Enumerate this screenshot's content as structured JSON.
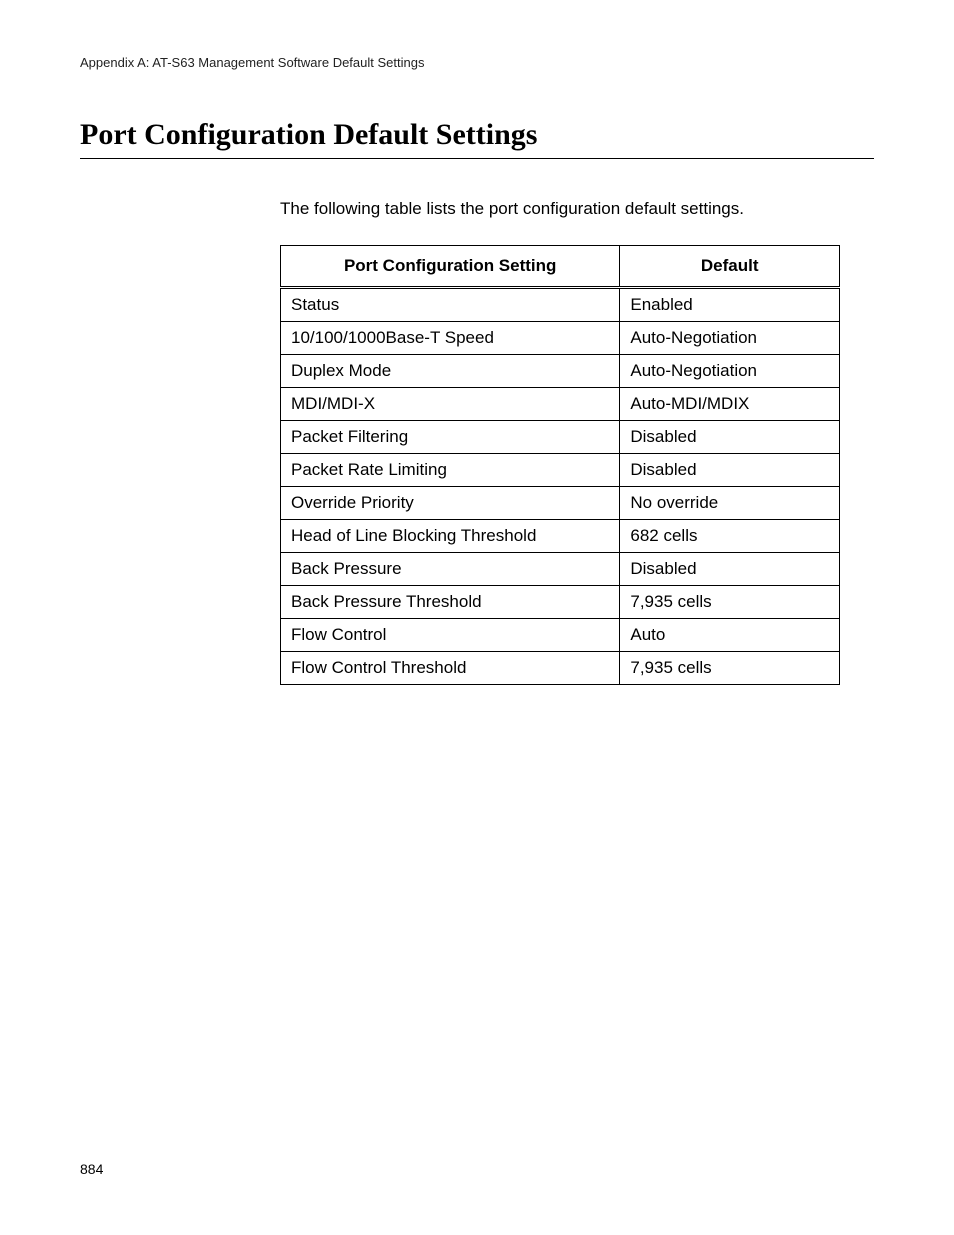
{
  "header": {
    "text": "Appendix A: AT-S63 Management Software Default Settings"
  },
  "title": "Port Configuration Default Settings",
  "intro": "The following table lists the port configuration default settings.",
  "chart_data": {
    "type": "table",
    "columns": [
      "Port Configuration Setting",
      "Default"
    ],
    "rows": [
      {
        "setting": "Status",
        "default": "Enabled"
      },
      {
        "setting": "10/100/1000Base-T Speed",
        "default": "Auto-Negotiation"
      },
      {
        "setting": "Duplex Mode",
        "default": "Auto-Negotiation"
      },
      {
        "setting": "MDI/MDI-X",
        "default": "Auto-MDI/MDIX"
      },
      {
        "setting": "Packet Filtering",
        "default": "Disabled"
      },
      {
        "setting": "Packet Rate Limiting",
        "default": "Disabled"
      },
      {
        "setting": "Override Priority",
        "default": "No override"
      },
      {
        "setting": "Head of Line Blocking Threshold",
        "default": "682 cells"
      },
      {
        "setting": "Back Pressure",
        "default": "Disabled"
      },
      {
        "setting": "Back Pressure Threshold",
        "default": "7,935 cells"
      },
      {
        "setting": "Flow Control",
        "default": "Auto"
      },
      {
        "setting": "Flow Control Threshold",
        "default": "7,935 cells"
      }
    ]
  },
  "page_number": "884"
}
